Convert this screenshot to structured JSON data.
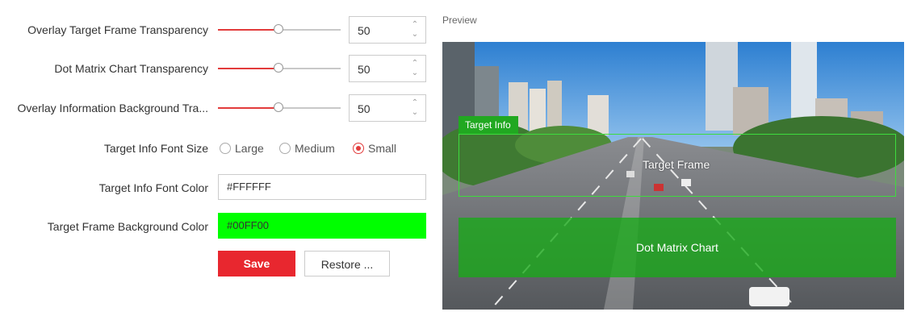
{
  "settings": {
    "overlay_target_frame": {
      "label": "Overlay Target Frame Transparency",
      "value": "50",
      "fraction": 0.5
    },
    "dot_matrix": {
      "label": "Dot Matrix Chart Transparency",
      "value": "50",
      "fraction": 0.5
    },
    "overlay_info_bg": {
      "label": "Overlay Information Background Tra...",
      "value": "50",
      "fraction": 0.5
    },
    "font_size": {
      "label": "Target Info Font Size",
      "options": [
        "Large",
        "Medium",
        "Small"
      ],
      "selected": "Small"
    },
    "font_color": {
      "label": "Target Info Font Color",
      "value": "#FFFFFF"
    },
    "frame_bg_color": {
      "label": "Target Frame Background Color",
      "value": "#00FF00",
      "swatch": "#00FF00"
    }
  },
  "buttons": {
    "save": "Save",
    "restore": "Restore ..."
  },
  "preview": {
    "label": "Preview",
    "target_info": "Target Info",
    "target_frame": "Target Frame",
    "dot_matrix": "Dot Matrix Chart"
  },
  "colors": {
    "accent": "#e8272f",
    "overlay_green": "#21a821"
  },
  "icons": {
    "spin_up": "chevron-up-icon",
    "spin_down": "chevron-down-icon"
  }
}
